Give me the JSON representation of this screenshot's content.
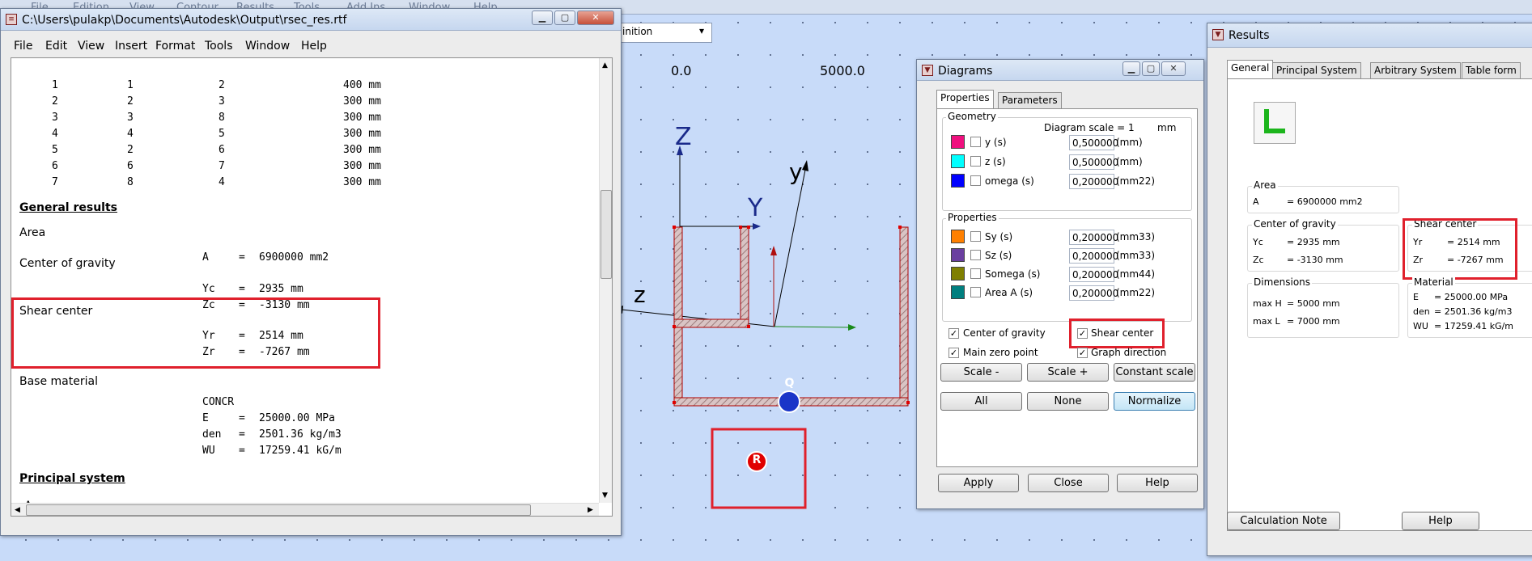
{
  "app": {
    "menu": [
      "File",
      "Edition",
      "View",
      "Contour",
      "Results",
      "Tools",
      "Add Ins",
      "Window",
      "Help"
    ],
    "combo_value": "inition",
    "ruler_labels": [
      "0.0",
      "5000.0"
    ],
    "axes": {
      "z_up": "Z",
      "y_main": "Y",
      "y_rot": "y",
      "z_left": "z"
    },
    "markers": {
      "q": "Q",
      "r": "R"
    }
  },
  "doc_window": {
    "title": "C:\\Users\\pulakp\\Documents\\Autodesk\\Output\\rsec_res.rtf",
    "menu": [
      "File",
      "Edit",
      "View",
      "Insert",
      "Format",
      "Tools",
      "Window",
      "Help"
    ],
    "segments": [
      {
        "n": "1",
        "a": "1",
        "b": "2",
        "len": "400 mm"
      },
      {
        "n": "2",
        "a": "2",
        "b": "3",
        "len": "300 mm"
      },
      {
        "n": "3",
        "a": "3",
        "b": "8",
        "len": "300 mm"
      },
      {
        "n": "4",
        "a": "4",
        "b": "5",
        "len": "300 mm"
      },
      {
        "n": "5",
        "a": "2",
        "b": "6",
        "len": "300 mm"
      },
      {
        "n": "6",
        "a": "6",
        "b": "7",
        "len": "300 mm"
      },
      {
        "n": "7",
        "a": "8",
        "b": "4",
        "len": "300 mm"
      }
    ],
    "general_results": "General results",
    "area_label": "Area",
    "area": {
      "key": "A",
      "eq": "=",
      "val": "6900000 mm2"
    },
    "cog_label": "Center of gravity",
    "yc": {
      "key": "Yc",
      "eq": "=",
      "val": "2935 mm"
    },
    "zc": {
      "key": "Zc",
      "eq": "=",
      "val": "-3130 mm"
    },
    "shear_label": "Shear center",
    "yr": {
      "key": "Yr",
      "eq": "=",
      "val": "2514 mm"
    },
    "zr": {
      "key": "Zr",
      "eq": "=",
      "val": "-7267 mm"
    },
    "base_material_label": "Base material",
    "mat_name": "CONCR",
    "e": {
      "key": "E",
      "eq": "=",
      "val": "25000.00 MPa"
    },
    "den": {
      "key": "den",
      "eq": "=",
      "val": "2501.36 kg/m3"
    },
    "wu": {
      "key": "WU",
      "eq": "=",
      "val": "17259.41 kG/m"
    },
    "principal_system": "Principal system",
    "cut_text": "A"
  },
  "diagrams": {
    "title": "Diagrams",
    "tabs": [
      "Properties",
      "Parameters"
    ],
    "geometry_label": "Geometry",
    "diagram_scale": "Diagram scale = 1",
    "scale_unit": "mm",
    "geometry_rows": [
      {
        "color": "#f0107f",
        "label": "y (s)",
        "value": "0,500000",
        "unit": "(mm)"
      },
      {
        "color": "#00ffff",
        "label": "z (s)",
        "value": "0,500000",
        "unit": "(mm)"
      },
      {
        "color": "#0000ff",
        "label": "omega (s)",
        "value": "0,200000",
        "unit": "(mm22)"
      }
    ],
    "properties_label": "Properties",
    "property_rows": [
      {
        "color": "#ff8000",
        "label": "Sy (s)",
        "value": "0,200000",
        "unit": "(mm33)"
      },
      {
        "color": "#6a3fa0",
        "label": "Sz (s)",
        "value": "0,200000",
        "unit": "(mm33)"
      },
      {
        "color": "#7f7f00",
        "label": "Somega (s)",
        "value": "0,200000",
        "unit": "(mm44)"
      },
      {
        "color": "#007f7f",
        "label": "Area A (s)",
        "value": "0,200000",
        "unit": "(mm22)"
      }
    ],
    "checks": {
      "cog": "Center of gravity",
      "shear": "Shear center",
      "zero": "Main zero point",
      "graph": "Graph direction"
    },
    "check_mark": "✓",
    "buttons": {
      "scale_minus": "Scale -",
      "scale_plus": "Scale +",
      "constant": "Constant scale",
      "all": "All",
      "none": "None",
      "normalize": "Normalize",
      "apply": "Apply",
      "close": "Close",
      "help": "Help"
    }
  },
  "results": {
    "title": "Results",
    "tabs": [
      "General",
      "Principal System",
      "Arbitrary System",
      "Table form"
    ],
    "area_label": "Area",
    "area": {
      "key": "A",
      "val": "= 6900000 mm2"
    },
    "cog_label": "Center of gravity",
    "yc": {
      "key": "Yc",
      "val": "= 2935 mm"
    },
    "zc": {
      "key": "Zc",
      "val": "= -3130 mm"
    },
    "shear_label": "Shear center",
    "yr": {
      "key": "Yr",
      "val": "= 2514 mm"
    },
    "zr": {
      "key": "Zr",
      "val": "= -7267 mm"
    },
    "dim_label": "Dimensions",
    "maxh": {
      "key": "max H",
      "val": "= 5000 mm"
    },
    "maxl": {
      "key": "max L",
      "val": "= 7000 mm"
    },
    "mat_label": "Material",
    "e": {
      "key": "E",
      "val": "= 25000.00 MPa"
    },
    "den": {
      "key": "den",
      "val": "= 2501.36 kg/m3"
    },
    "wu": {
      "key": "WU",
      "val": "= 17259.41 kG/m"
    },
    "buttons": {
      "calc": "Calculation Note",
      "help": "Help"
    }
  },
  "colors": {
    "highlight": "#e0202c",
    "accent_blue": "#3c7fb1"
  }
}
